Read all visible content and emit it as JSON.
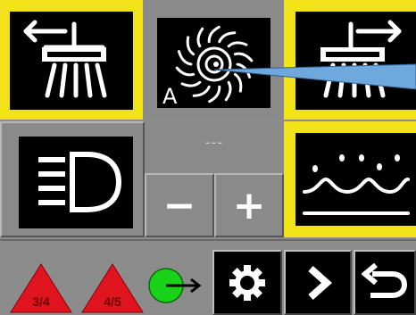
{
  "screen": {
    "name": "machine-control-panel"
  },
  "tiles": {
    "brush_left": {
      "icon": "brush-left-arrow-icon",
      "selected": true
    },
    "rotor_auto": {
      "icon": "rotor-auto-icon",
      "mode_letter": "A",
      "selected": false
    },
    "brush_right": {
      "icon": "brush-right-arrow-icon",
      "selected": true
    },
    "work_light": {
      "icon": "headlight-icon",
      "selected": false
    },
    "water_spray": {
      "icon": "water-spray-icon",
      "selected": true
    }
  },
  "value_display": {
    "text": "---"
  },
  "stepper": {
    "minus_label": "−",
    "plus_label": "+"
  },
  "warnings": [
    {
      "label": "3/4",
      "icon": "warning-triangle-icon",
      "color": "#e0141e"
    },
    {
      "label": "4/5",
      "icon": "warning-triangle-icon",
      "color": "#e0141e"
    }
  ],
  "status_indicator": {
    "icon": "green-output-indicator-icon",
    "color": "#1bd21b"
  },
  "softkeys": [
    {
      "icon": "gear-icon"
    },
    {
      "icon": "chevron-right-icon"
    },
    {
      "icon": "return-arrow-icon"
    }
  ],
  "colors": {
    "selected": "#f2e21a",
    "tile_bg": "#000000",
    "panel": "#8c8c8c",
    "pointer": "#6fa8dc"
  }
}
